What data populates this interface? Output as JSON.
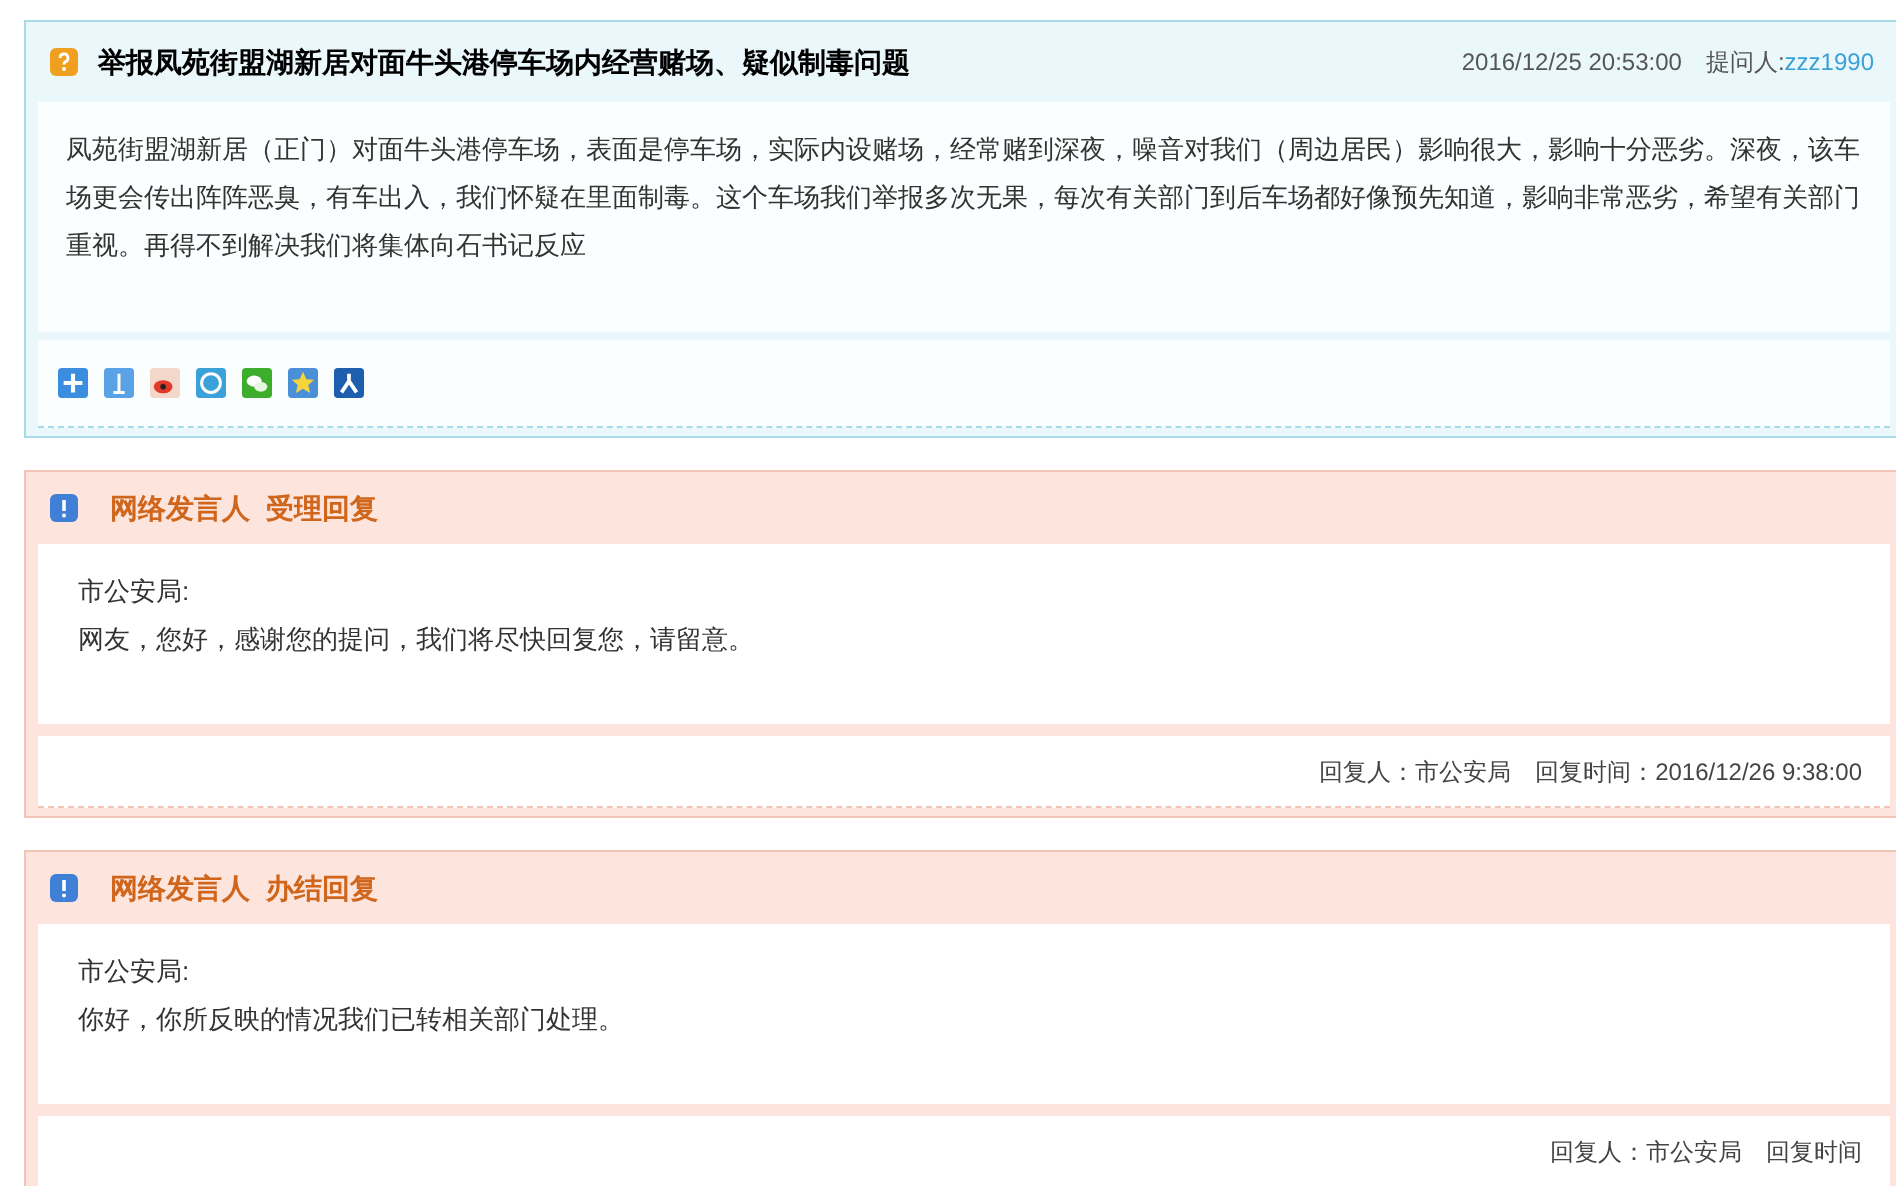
{
  "question": {
    "title": "举报凤苑街盟湖新居对面牛头港停车场内经营赌场、疑似制毒问题",
    "date": "2016/12/25 20:53:00",
    "asker_label": "提问人:",
    "asker": "zzz1990",
    "body": "凤苑街盟湖新居（正门）对面牛头港停车场，表面是停车场，实际内设赌场，经常赌到深夜，噪音对我们（周边居民）影响很大，影响十分恶劣。深夜，该车场更会传出阵阵恶臭，有车出入，我们怀疑在里面制毒。这个车场我们举报多次无果，每次有关部门到后车场都好像预先知道，影响非常恶劣，希望有关部门重视。再得不到解决我们将集体向石书记反应"
  },
  "replies": [
    {
      "title": "网络发言人  受理回复",
      "org": "市公安局:",
      "message": "网友，您好，感谢您的提问，我们将尽快回复您，请留意。",
      "replier": "回复人：市公安局",
      "time": "回复时间：2016/12/26 9:38:00"
    },
    {
      "title": "网络发言人  办结回复",
      "org": "市公安局:",
      "message": "你好，你所反映的情况我们已转相关部门处理。",
      "replier": "回复人：市公安局",
      "time": "回复时间"
    }
  ]
}
